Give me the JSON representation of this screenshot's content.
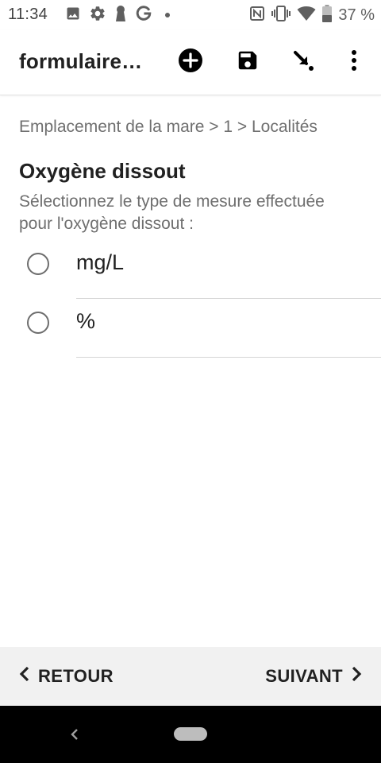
{
  "status_bar": {
    "time": "11:34",
    "battery_text": "37 %",
    "left_icons": [
      "image-icon",
      "settings-icon",
      "keyhole-icon",
      "google-icon",
      "notification-dot"
    ],
    "right_icons": [
      "nfc-icon",
      "vibrate-icon",
      "wifi-icon",
      "battery-icon"
    ]
  },
  "app_bar": {
    "title": "formulaire…",
    "actions": [
      "add-circle-icon",
      "save-icon",
      "go-to-icon",
      "more-vert-icon"
    ]
  },
  "form": {
    "breadcrumb": "Emplacement de la mare > 1 > Localités",
    "question_title": "Oxygène dissout",
    "question_hint": "Sélectionnez le type de mesure effectuée pour l'oxygène dissout :",
    "options": [
      {
        "label": "mg/L",
        "selected": false
      },
      {
        "label": "%",
        "selected": false
      }
    ]
  },
  "bottom_nav": {
    "back_label": "RETOUR",
    "next_label": "SUIVANT"
  },
  "colors": {
    "text_primary": "#212121",
    "text_secondary": "#6f6f6f",
    "bottom_nav_bg": "#f1f1f1",
    "system_bar_bg": "#000000"
  }
}
